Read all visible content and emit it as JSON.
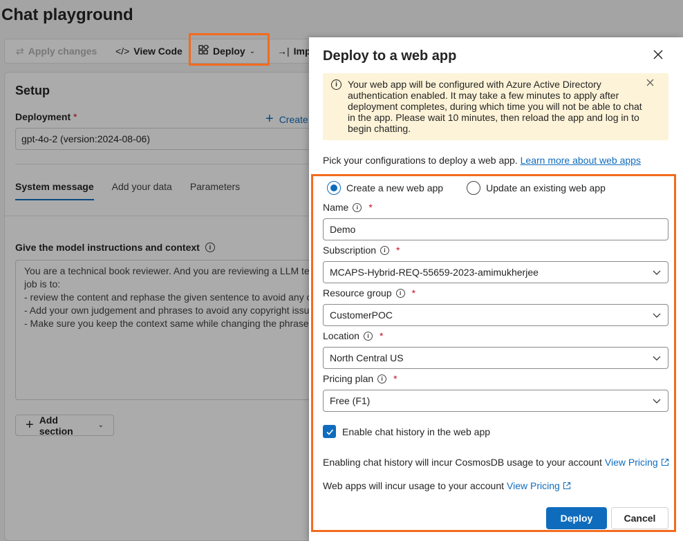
{
  "page": {
    "title": "Chat playground"
  },
  "toolbar": {
    "apply_changes": "Apply changes",
    "view_code": "View Code",
    "deploy": "Deploy",
    "import": "Imp"
  },
  "setup": {
    "title": "Setup",
    "deployment_label": "Deployment",
    "required_mark": "*",
    "create_new": "Create",
    "deployment_value": "gpt-4o-2 (version:2024-08-06)",
    "tabs": [
      {
        "label": "System message"
      },
      {
        "label": "Add your data"
      },
      {
        "label": "Parameters"
      }
    ],
    "instructions_label": "Give the model instructions and context",
    "system_message_lines": [
      "You are a technical book reviewer. And you are reviewing a LLM tec",
      "job is to:",
      "- review the content and rephase the given sentence to avoid any c",
      "- Add your own judgement and phrases to avoid any copyright issu",
      "- Make sure you keep the context same while changing the phrase"
    ],
    "add_section": "Add section"
  },
  "dialog": {
    "title": "Deploy to a web app",
    "warning": "Your web app will be configured with Azure Active Directory authentication enabled. It may take a few minutes to apply after deployment completes, during which time you will not be able to chat in the app. Please wait 10 minutes, then reload the app and log in to begin chatting.",
    "intro_text": "Pick your configurations to deploy a web app.",
    "intro_link": "Learn more about web apps",
    "radio_create": "Create a new web app",
    "radio_update": "Update an existing web app",
    "selected_option": "create",
    "name_label": "Name",
    "name_value": "Demo",
    "subscription_label": "Subscription",
    "subscription_value": "MCAPS-Hybrid-REQ-55659-2023-amimukherjee",
    "resource_group_label": "Resource group",
    "resource_group_value": "CustomerPOC",
    "location_label": "Location",
    "location_value": "North Central US",
    "pricing_label": "Pricing plan",
    "pricing_value": "Free (F1)",
    "chat_history_label": "Enable chat history in the web app",
    "chat_history_checked": true,
    "cosmos_note": "Enabling chat history will incur CosmosDB usage to your account",
    "cosmos_link": "View Pricing",
    "webapp_note": "Web apps will incur usage to your account",
    "webapp_link": "View Pricing",
    "deploy_button": "Deploy",
    "cancel_button": "Cancel",
    "required_mark": "*"
  },
  "colors": {
    "accent": "#0f6cbd",
    "highlight": "#f26b1d",
    "warning_bg": "#fdf3d8",
    "required": "#c50f1f"
  },
  "icons": {
    "apply": "arrows-swap-icon",
    "code": "code-icon",
    "deploy": "apps-add-icon",
    "import": "arrow-import-icon",
    "close": "close-icon",
    "info": "info-icon",
    "chevron": "chevron-down-icon",
    "external": "open-external-icon",
    "check": "checkmark-icon",
    "plus": "plus-icon"
  }
}
